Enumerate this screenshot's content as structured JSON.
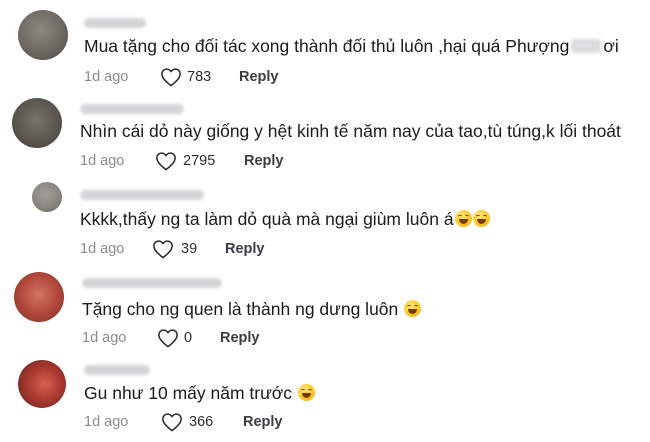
{
  "comments": [
    {
      "text_before": "Mua tặng cho đối tác xong thành đối thủ luôn ,hại quá Phượng",
      "text_after": "ơi",
      "emoji": "",
      "time": "1d ago",
      "likes": "783",
      "reply_label": "Reply",
      "avatar_color": "#6e6862"
    },
    {
      "text_before": "Nhìn cái dỏ này giống y hệt kinh tế năm nay của tao,tù túng,k lối thoát",
      "text_after": "",
      "emoji": "",
      "time": "1d ago",
      "likes": "2795",
      "reply_label": "Reply",
      "avatar_color": "#5b574f"
    },
    {
      "text_before": "Kkkk,thấy ng ta làm dỏ quà mà ngại giùm luôn á",
      "text_after": "",
      "emoji": "rofl-emoji-x2",
      "time": "1d ago",
      "likes": "39",
      "reply_label": "Reply",
      "avatar_color": "#8a8580"
    },
    {
      "text_before": "Tặng cho ng quen là thành ng dưng luôn",
      "text_after": "",
      "emoji": "tears-of-joy-emoji",
      "time": "1d ago",
      "likes": "0",
      "reply_label": "Reply",
      "avatar_color": "#b2493c"
    },
    {
      "text_before": "Gu như 10 mấy năm trước",
      "text_after": "",
      "emoji": "tears-of-joy-emoji",
      "time": "1d ago",
      "likes": "366",
      "reply_label": "Reply",
      "avatar_color": "#a5372e"
    }
  ],
  "colors": {
    "text": "#1b1b1f",
    "meta": "#8a8b91",
    "reply": "#3b3c44"
  }
}
